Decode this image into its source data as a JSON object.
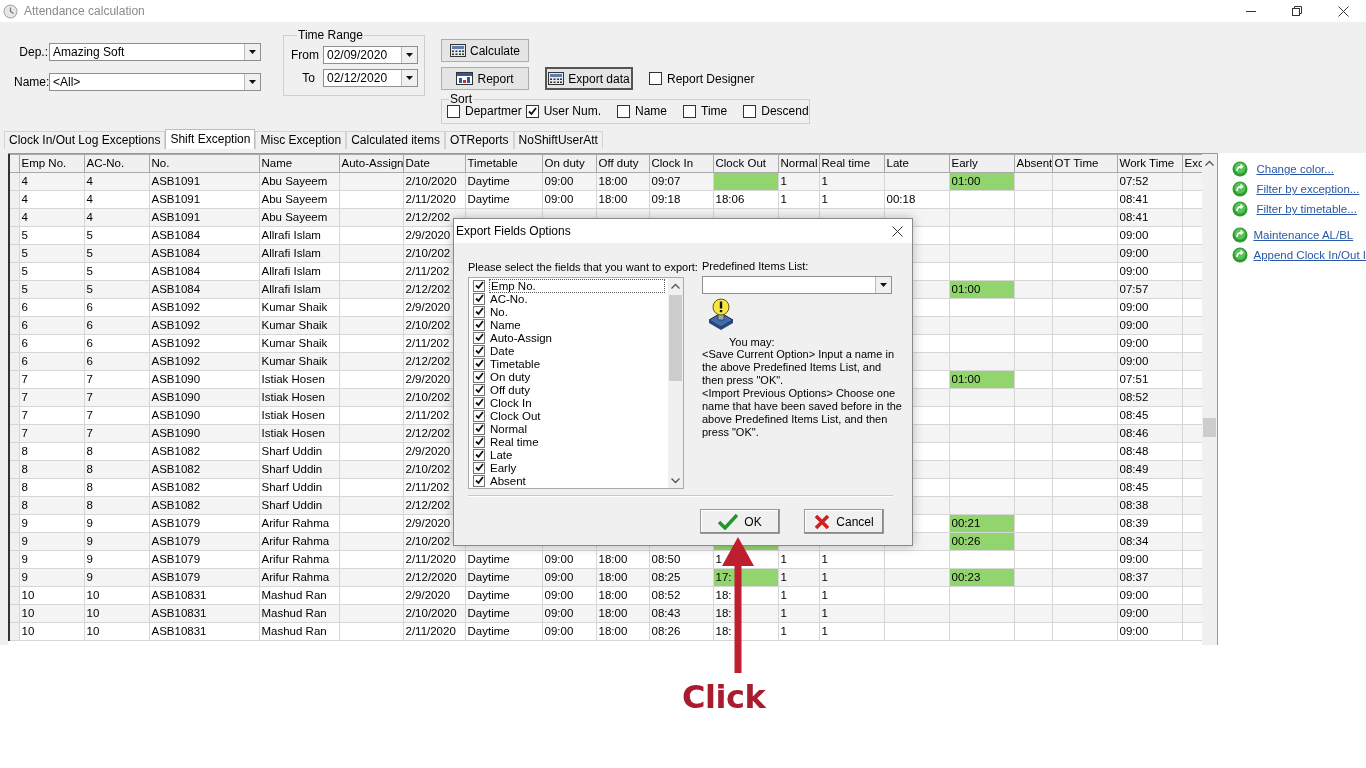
{
  "window": {
    "title": "Attendance calculation"
  },
  "filters": [
    {
      "label": "Dep.:",
      "value": "Amazing Soft"
    },
    {
      "label": "Name:",
      "value": "<All>"
    }
  ],
  "time_range": {
    "title": "Time Range",
    "fields": [
      {
        "label": "From",
        "value": "02/09/2020"
      },
      {
        "label": "To",
        "value": "02/12/2020"
      }
    ]
  },
  "buttons": [
    {
      "label": "Calculate",
      "kind": "calculator"
    },
    {
      "label": "Report",
      "kind": "report"
    },
    {
      "label": "Export data",
      "kind": "calculator"
    }
  ],
  "report_designer": {
    "label": "Report Designer",
    "checked": false
  },
  "sort": {
    "title": "Sort",
    "options": [
      {
        "label": "Departmer",
        "checked": false
      },
      {
        "label": "User Num.",
        "checked": true
      },
      {
        "label": "Name",
        "checked": false
      },
      {
        "label": "Time",
        "checked": false
      },
      {
        "label": "Descend",
        "checked": false
      }
    ]
  },
  "tabs": [
    {
      "label": "Clock In/Out Log Exceptions",
      "selected": false
    },
    {
      "label": "Shift Exception",
      "selected": true
    },
    {
      "label": "Misc Exception",
      "selected": false
    },
    {
      "label": "Calculated items",
      "selected": false
    },
    {
      "label": "OTReports",
      "selected": false
    },
    {
      "label": "NoShiftUserAtt",
      "selected": false
    }
  ],
  "table": {
    "columns": [
      "Emp No.",
      "AC-No.",
      "No.",
      "Name",
      "Auto-Assign",
      "Date",
      "Timetable",
      "On duty",
      "Off duty",
      "Clock In",
      "Clock Out",
      "Normal",
      "Real time",
      "Late",
      "Early",
      "Absent",
      "OT Time",
      "Work Time",
      "Exc"
    ],
    "rows": [
      {
        "cells": [
          "4",
          "4",
          "ASB1091",
          "Abu Sayeem",
          null,
          "2/10/2020",
          "Daytime",
          "09:00",
          "18:00",
          "09:07",
          null,
          "1",
          "1",
          null,
          "01:00",
          null,
          null,
          "07:52",
          null
        ],
        "clock_out_alert": true,
        "early_alert": true
      },
      {
        "cells": [
          "4",
          "4",
          "ASB1091",
          "Abu Sayeem",
          null,
          "2/11/2020",
          "Daytime",
          "09:00",
          "18:00",
          "09:18",
          "18:06",
          "1",
          "1",
          "00:18",
          null,
          null,
          null,
          "08:41",
          null
        ],
        "clock_out_alert": false,
        "early_alert": false
      },
      {
        "cells": [
          "4",
          "4",
          "ASB1091",
          "Abu Sayeem",
          null,
          "2/12/202",
          null,
          null,
          null,
          null,
          null,
          null,
          null,
          null,
          null,
          null,
          null,
          "08:41",
          null
        ],
        "early_alert": false
      },
      {
        "cells": [
          "5",
          "5",
          "ASB1084",
          "Allrafi Islam",
          null,
          "2/9/2020",
          null,
          null,
          null,
          null,
          null,
          null,
          null,
          null,
          null,
          null,
          null,
          "09:00",
          null
        ],
        "early_alert": false
      },
      {
        "cells": [
          "5",
          "5",
          "ASB1084",
          "Allrafi Islam",
          null,
          "2/10/202",
          null,
          null,
          null,
          null,
          null,
          null,
          null,
          null,
          null,
          null,
          null,
          "09:00",
          null
        ],
        "early_alert": false
      },
      {
        "cells": [
          "5",
          "5",
          "ASB1084",
          "Allrafi Islam",
          null,
          "2/11/202",
          null,
          null,
          null,
          null,
          null,
          null,
          null,
          null,
          null,
          null,
          null,
          "09:00",
          null
        ],
        "early_alert": false
      },
      {
        "cells": [
          "5",
          "5",
          "ASB1084",
          "Allrafi Islam",
          null,
          "2/12/202",
          null,
          null,
          null,
          null,
          null,
          null,
          null,
          null,
          "01:00",
          null,
          null,
          "07:57",
          null
        ],
        "early_alert": true
      },
      {
        "cells": [
          "6",
          "6",
          "ASB1092",
          "Kumar Shaik",
          null,
          "2/9/2020",
          null,
          null,
          null,
          null,
          null,
          null,
          null,
          null,
          null,
          null,
          null,
          "09:00",
          null
        ],
        "early_alert": false
      },
      {
        "cells": [
          "6",
          "6",
          "ASB1092",
          "Kumar Shaik",
          null,
          "2/10/202",
          null,
          null,
          null,
          null,
          null,
          null,
          null,
          null,
          null,
          null,
          null,
          "09:00",
          null
        ],
        "early_alert": false
      },
      {
        "cells": [
          "6",
          "6",
          "ASB1092",
          "Kumar Shaik",
          null,
          "2/11/202",
          null,
          null,
          null,
          null,
          null,
          null,
          null,
          null,
          null,
          null,
          null,
          "09:00",
          null
        ],
        "early_alert": false
      },
      {
        "cells": [
          "6",
          "6",
          "ASB1092",
          "Kumar Shaik",
          null,
          "2/12/202",
          null,
          null,
          null,
          null,
          null,
          null,
          null,
          null,
          null,
          null,
          null,
          "09:00",
          null
        ],
        "early_alert": false
      },
      {
        "cells": [
          "7",
          "7",
          "ASB1090",
          "Istiak Hosen",
          null,
          "2/9/2020",
          null,
          null,
          null,
          null,
          null,
          null,
          null,
          null,
          "01:00",
          null,
          null,
          "07:51",
          null
        ],
        "early_alert": true
      },
      {
        "cells": [
          "7",
          "7",
          "ASB1090",
          "Istiak Hosen",
          null,
          "2/10/202",
          null,
          null,
          null,
          null,
          null,
          null,
          null,
          null,
          null,
          null,
          null,
          "08:52",
          null
        ],
        "early_alert": false
      },
      {
        "cells": [
          "7",
          "7",
          "ASB1090",
          "Istiak Hosen",
          null,
          "2/11/202",
          null,
          null,
          null,
          null,
          null,
          null,
          null,
          null,
          null,
          null,
          null,
          "08:45",
          null
        ],
        "early_alert": false
      },
      {
        "cells": [
          "7",
          "7",
          "ASB1090",
          "Istiak Hosen",
          null,
          "2/12/202",
          null,
          null,
          null,
          null,
          null,
          null,
          null,
          null,
          null,
          null,
          null,
          "08:46",
          null
        ],
        "early_alert": false
      },
      {
        "cells": [
          "8",
          "8",
          "ASB1082",
          "Sharf Uddin",
          null,
          "2/9/2020",
          null,
          null,
          null,
          null,
          null,
          null,
          null,
          null,
          null,
          null,
          null,
          "08:48",
          null
        ],
        "early_alert": false
      },
      {
        "cells": [
          "8",
          "8",
          "ASB1082",
          "Sharf Uddin",
          null,
          "2/10/202",
          null,
          null,
          null,
          null,
          null,
          null,
          null,
          null,
          null,
          null,
          null,
          "08:49",
          null
        ],
        "early_alert": false
      },
      {
        "cells": [
          "8",
          "8",
          "ASB1082",
          "Sharf Uddin",
          null,
          "2/11/202",
          null,
          null,
          null,
          null,
          null,
          null,
          null,
          null,
          null,
          null,
          null,
          "08:45",
          null
        ],
        "early_alert": false
      },
      {
        "cells": [
          "8",
          "8",
          "ASB1082",
          "Sharf Uddin",
          null,
          "2/12/202",
          null,
          null,
          null,
          null,
          null,
          null,
          null,
          null,
          null,
          null,
          null,
          "08:38",
          null
        ],
        "early_alert": false
      },
      {
        "cells": [
          "9",
          "9",
          "ASB1079",
          "Arifur Rahma",
          null,
          "2/9/2020",
          null,
          null,
          null,
          null,
          null,
          null,
          null,
          null,
          "00:21",
          null,
          null,
          "08:39",
          null
        ],
        "early_alert": true
      },
      {
        "cells": [
          "9",
          "9",
          "ASB1079",
          "Arifur Rahma",
          null,
          "2/10/202",
          null,
          null,
          null,
          null,
          null,
          null,
          null,
          null,
          "00:26",
          null,
          null,
          "08:34",
          null
        ],
        "clock_out_alert": true,
        "early_alert": true
      },
      {
        "cells": [
          "9",
          "9",
          "ASB1079",
          "Arifur Rahma",
          null,
          "2/11/2020",
          "Daytime",
          "09:00",
          "18:00",
          "08:50",
          "1",
          "1",
          "1",
          null,
          null,
          null,
          null,
          "09:00",
          null
        ],
        "clock_out_alert": false,
        "early_alert": false
      },
      {
        "cells": [
          "9",
          "9",
          "ASB1079",
          "Arifur Rahma",
          null,
          "2/12/2020",
          "Daytime",
          "09:00",
          "18:00",
          "08:25",
          "17:",
          "1",
          "1",
          null,
          "00:23",
          null,
          null,
          "08:37",
          null
        ],
        "clock_out_alert": true,
        "early_alert": true
      },
      {
        "cells": [
          "10",
          "10",
          "ASB10831",
          "Mashud Ran",
          null,
          "2/9/2020",
          "Daytime",
          "09:00",
          "18:00",
          "08:52",
          "18:",
          "1",
          "1",
          null,
          null,
          null,
          null,
          "09:00",
          null
        ],
        "clock_out_alert": false,
        "early_alert": false
      },
      {
        "cells": [
          "10",
          "10",
          "ASB10831",
          "Mashud Ran",
          null,
          "2/10/2020",
          "Daytime",
          "09:00",
          "18:00",
          "08:43",
          "18:",
          "1",
          "1",
          null,
          null,
          null,
          null,
          "09:00",
          null
        ],
        "clock_out_alert": false,
        "early_alert": false
      },
      {
        "cells": [
          "10",
          "10",
          "ASB10831",
          "Mashud Ran",
          null,
          "2/11/2020",
          "Daytime",
          "09:00",
          "18:00",
          "08:26",
          "18:",
          "1",
          "1",
          null,
          null,
          null,
          null,
          "09:00",
          null
        ],
        "clock_out_alert": false,
        "early_alert": false
      }
    ]
  },
  "side_links": [
    [
      "Change color...",
      "Filter by exception...",
      "Filter by timetable..."
    ],
    [
      "Maintenance AL/BL",
      "Append Clock In/Out I"
    ]
  ],
  "dialog": {
    "title": "Export Fields Options",
    "prompt": "Please select the fields that you want to export:",
    "fields": [
      {
        "label": "Emp No.",
        "checked": true,
        "selected": true
      },
      {
        "label": "AC-No.",
        "checked": true,
        "selected": false
      },
      {
        "label": "No.",
        "checked": true,
        "selected": false
      },
      {
        "label": "Name",
        "checked": true,
        "selected": false
      },
      {
        "label": "Auto-Assign",
        "checked": true,
        "selected": false
      },
      {
        "label": "Date",
        "checked": true,
        "selected": false
      },
      {
        "label": "Timetable",
        "checked": true,
        "selected": false
      },
      {
        "label": "On duty",
        "checked": true,
        "selected": false
      },
      {
        "label": "Off duty",
        "checked": true,
        "selected": false
      },
      {
        "label": "Clock In",
        "checked": true,
        "selected": false
      },
      {
        "label": "Clock Out",
        "checked": true,
        "selected": false
      },
      {
        "label": "Normal",
        "checked": true,
        "selected": false
      },
      {
        "label": "Real time",
        "checked": true,
        "selected": false
      },
      {
        "label": "Late",
        "checked": true,
        "selected": false
      },
      {
        "label": "Early",
        "checked": true,
        "selected": false
      },
      {
        "label": "Absent",
        "checked": true,
        "selected": false
      }
    ],
    "predefined_label": "Predefined Items List:",
    "note_heading": "You may:",
    "note": [
      "<Save Current Option> Input a name in the above Predefined Items List, and then press \"OK\".",
      "<Import Previous Options> Choose one name that have been saved before in the above Predefined Items List, and then press \"OK\"."
    ],
    "buttons": [
      {
        "label": "OK",
        "kind": "ok"
      },
      {
        "label": "Cancel",
        "kind": "cancel"
      }
    ]
  },
  "annotation": {
    "label": "Click"
  }
}
